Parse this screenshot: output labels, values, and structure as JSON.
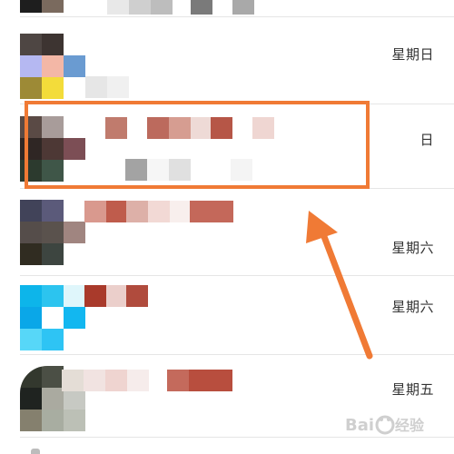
{
  "chat_list": {
    "items": [
      {
        "time": "星期日"
      },
      {
        "time": "日"
      },
      {
        "time": "星期六"
      },
      {
        "time": "星期六"
      },
      {
        "time": "星期五"
      }
    ]
  },
  "annotation": {
    "color": "#f07a35"
  }
}
